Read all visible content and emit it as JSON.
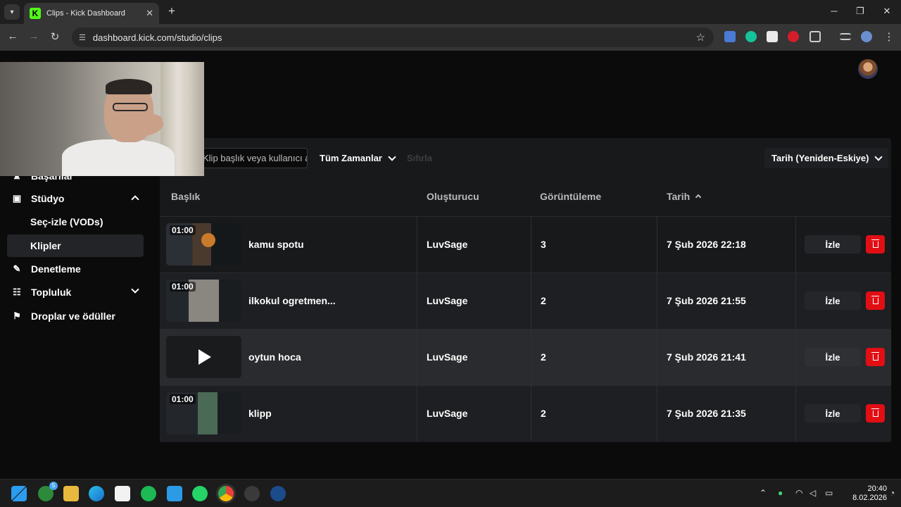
{
  "browser": {
    "tab_title": "Clips - Kick Dashboard",
    "favicon_letter": "K",
    "url": "dashboard.kick.com/studio/clips",
    "new_tab": "+",
    "close_tab": "✕"
  },
  "sidebar": {
    "items": [
      {
        "label": "Başarılar",
        "icon": "trophy-icon"
      },
      {
        "label": "Stüdyo",
        "icon": "studio-icon"
      },
      {
        "label": "Seç-izle (VODs)"
      },
      {
        "label": "Klipler"
      },
      {
        "label": "Denetleme",
        "icon": "wrench-icon"
      },
      {
        "label": "Topluluk",
        "icon": "community-icon"
      },
      {
        "label": "Droplar ve ödüller",
        "icon": "drops-icon"
      }
    ]
  },
  "filters": {
    "search_placeholder": "Klip başlık veya kullanıcı adı ara",
    "time_filter": "Tüm Zamanlar",
    "reset": "Sıfırla",
    "sort": "Tarih (Yeniden-Eskiye)"
  },
  "table": {
    "headers": {
      "title": "Başlık",
      "creator": "Oluşturucu",
      "views": "Görüntüleme",
      "date": "Tarih"
    },
    "watch_label": "İzle",
    "rows": [
      {
        "duration": "01:00",
        "title": "kamu spotu",
        "creator": "LuvSage",
        "views": "3",
        "date": "7 Şub 2026 22:18"
      },
      {
        "duration": "01:00",
        "title": "ilkokul ogretmen...",
        "creator": "LuvSage",
        "views": "2",
        "date": "7 Şub 2026 21:55"
      },
      {
        "duration": "",
        "title": "oytun hoca",
        "creator": "LuvSage",
        "views": "2",
        "date": "7 Şub 2026 21:41"
      },
      {
        "duration": "01:00",
        "title": "klipp",
        "creator": "LuvSage",
        "views": "2",
        "date": "7 Şub 2026 21:35"
      }
    ]
  },
  "taskbar": {
    "time": "20:40",
    "date": "8.02.2026",
    "notification_badge": "5"
  },
  "colors": {
    "brand": "#53fc18",
    "delete": "#e10e14",
    "panel": "#18191b"
  }
}
